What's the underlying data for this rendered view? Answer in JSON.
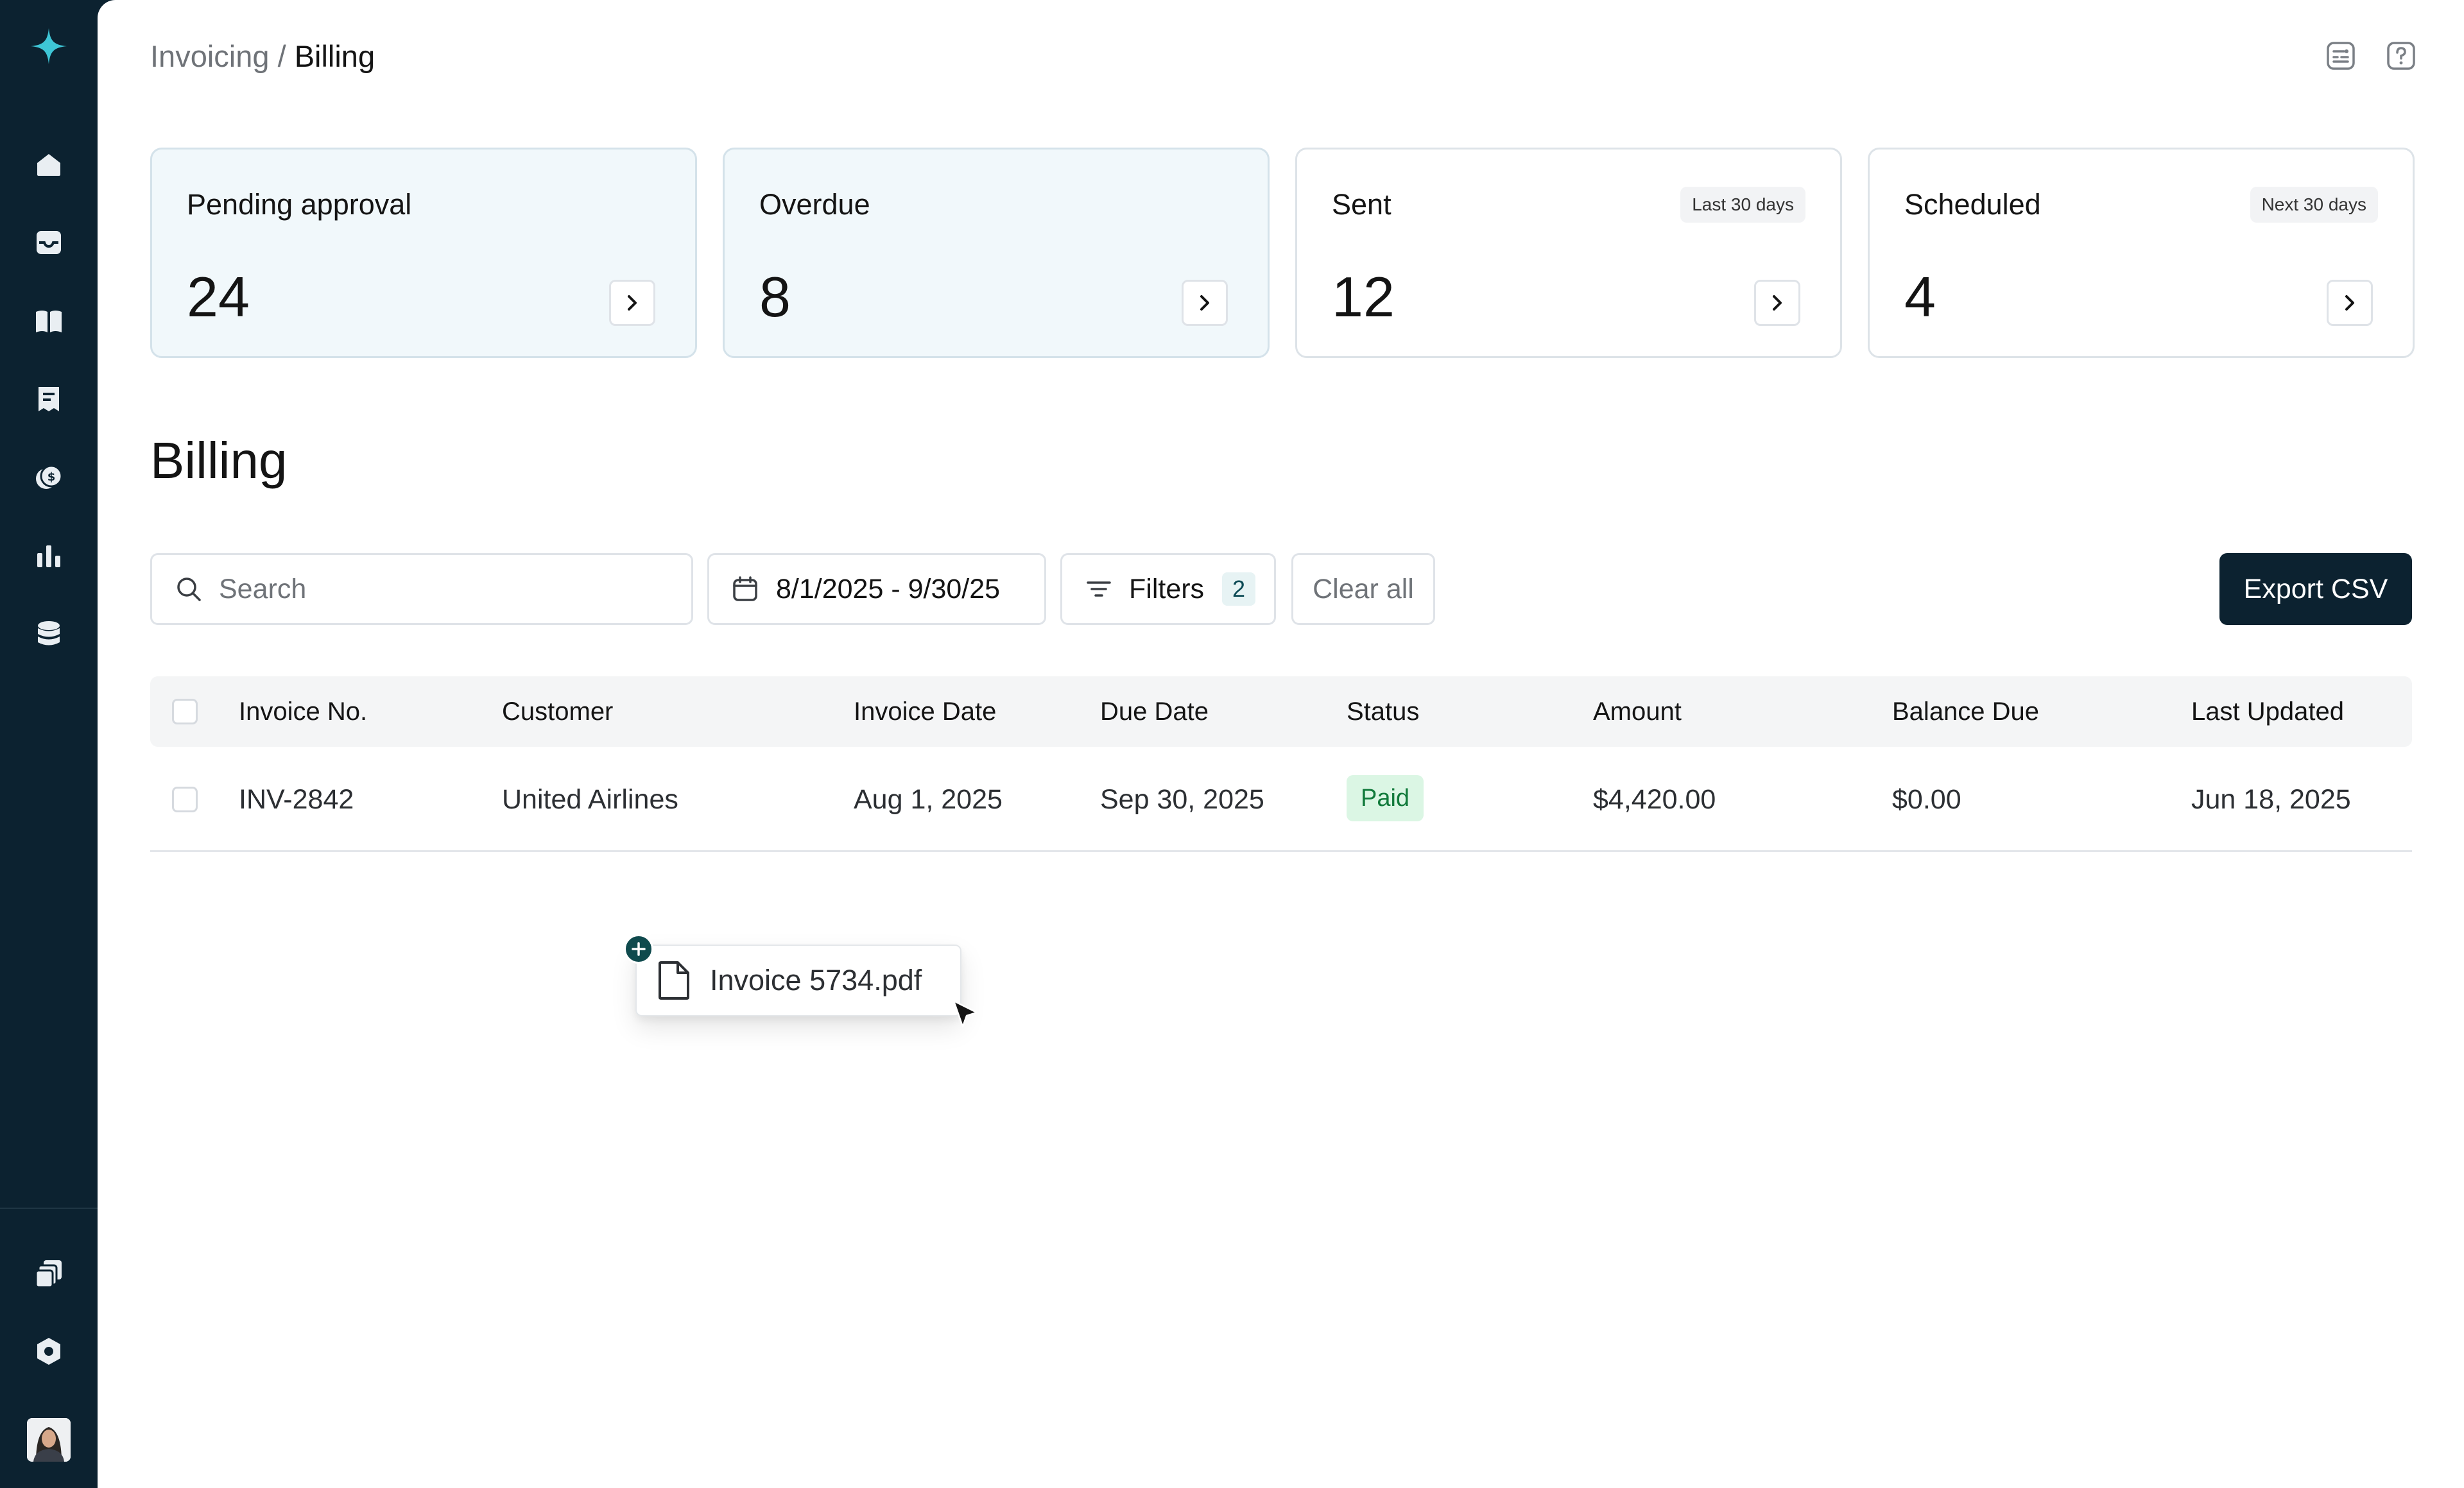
{
  "breadcrumb": {
    "parent": "Invoicing",
    "separator": "/",
    "current": "Billing"
  },
  "sidebar": {
    "icons": [
      "home-icon",
      "inbox-icon",
      "book-icon",
      "receipt-icon",
      "payments-icon",
      "reports-icon",
      "database-icon"
    ],
    "bottom_icons": [
      "documents-icon",
      "settings-icon"
    ]
  },
  "cards": [
    {
      "title": "Pending approval",
      "value": "24",
      "badge": ""
    },
    {
      "title": "Overdue",
      "value": "8",
      "badge": ""
    },
    {
      "title": "Sent",
      "value": "12",
      "badge": "Last 30 days"
    },
    {
      "title": "Scheduled",
      "value": "4",
      "badge": "Next 30 days"
    }
  ],
  "section_title": "Billing",
  "toolbar": {
    "search_placeholder": "Search",
    "date_range": "8/1/2025 - 9/30/25",
    "filters_label": "Filters",
    "filters_count": "2",
    "clear_all": "Clear all",
    "export": "Export CSV"
  },
  "table": {
    "columns": [
      "Invoice No.",
      "Customer",
      "Invoice Date",
      "Due Date",
      "Status",
      "Amount",
      "Balance Due",
      "Last Updated"
    ],
    "rows": [
      {
        "invoice_no": "INV-2842",
        "customer": "United Airlines",
        "invoice_date": "Aug 1, 2025",
        "due_date": "Sep 30, 2025",
        "status": "Paid",
        "amount": "$4,420.00",
        "balance_due": "$0.00",
        "last_updated": "Jun 18, 2025"
      }
    ]
  },
  "drag_file": {
    "name": "Invoice 5734.pdf"
  },
  "colors": {
    "sidebar": "#0c2230",
    "accent": "#3ec6d6",
    "paid_bg": "#dbf6e4",
    "paid_text": "#117a3b",
    "tinted_card": "#f1f8fb"
  }
}
